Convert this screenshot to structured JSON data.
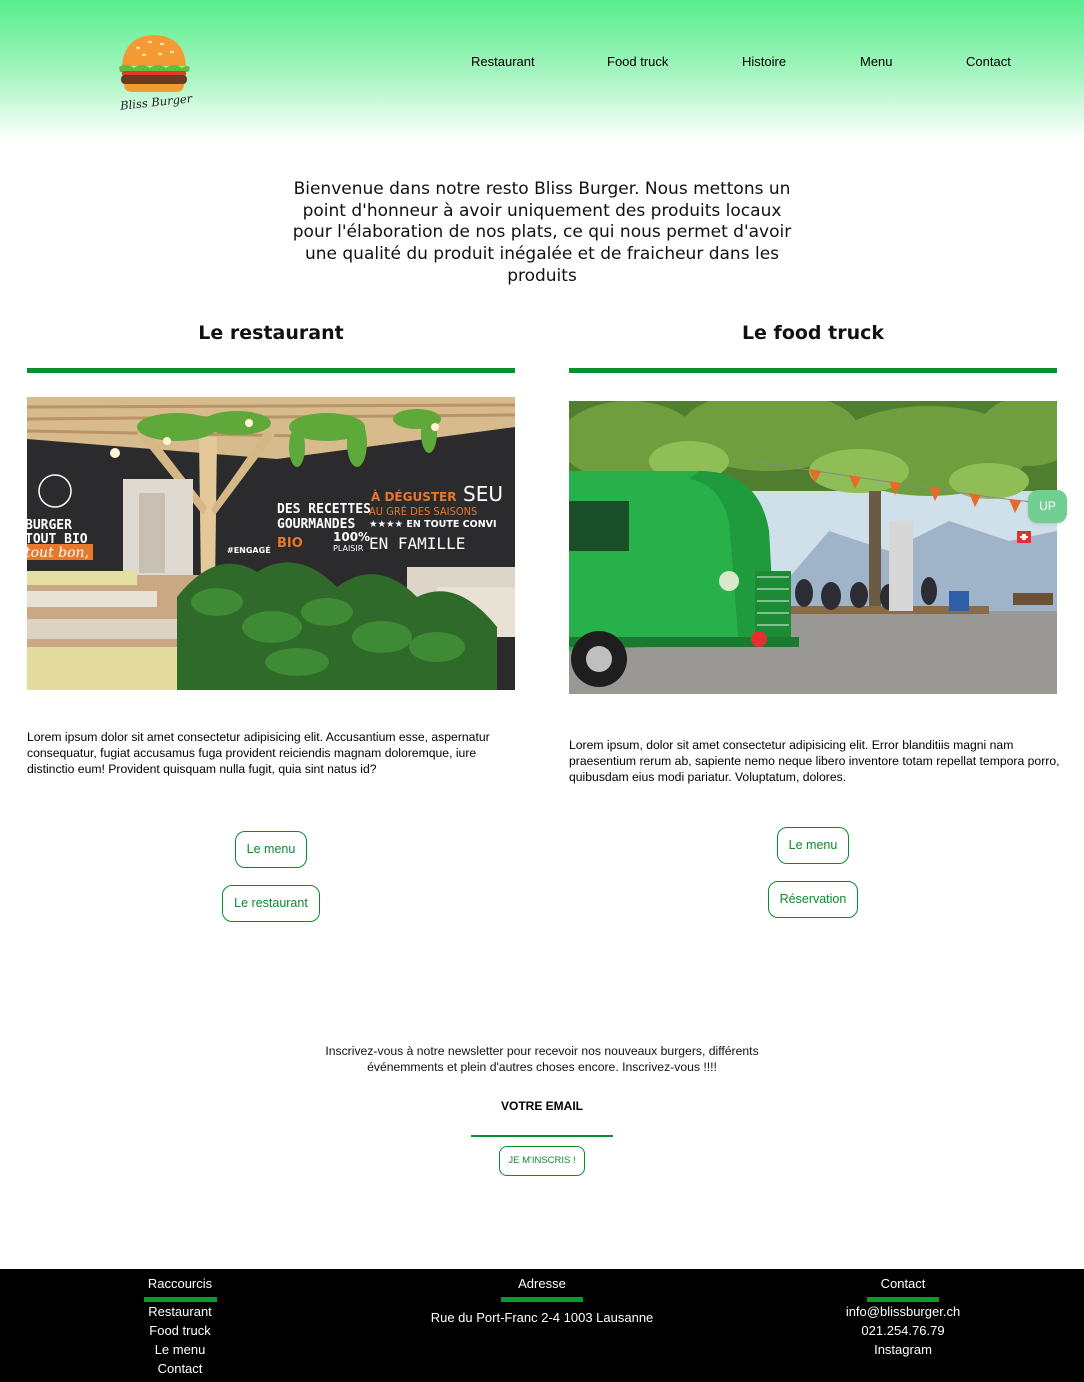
{
  "brand": {
    "logo_text": "Bliss Burger",
    "accent": "#07902d",
    "header_gradient_top": "#58ee8c"
  },
  "nav": {
    "items": [
      "Restaurant",
      "Food truck",
      "Histoire",
      "Menu",
      "Contact"
    ]
  },
  "intro": {
    "text": "Bienvenue dans notre resto Bliss Burger. Nous mettons un point d'honneur à avoir uniquement des produits locaux pour l'élaboration de nos plats, ce qui nous permet d'avoir une qualité du produit inégalée et de fraicheur dans les produits"
  },
  "restaurant": {
    "title": "Le restaurant",
    "text": "Lorem ipsum dolor sit amet consectetur adipisicing elit. Accusantium esse, aspernatur consequatur, fugiat accusamus fuga provident reiciendis magnam doloremque, iure distinctio eum! Provident quisquam nulla fugit, quia sint natus id?",
    "btn_menu": "Le menu",
    "btn_restaurant": "Le restaurant",
    "image": {
      "board_left_1": "BURGER",
      "board_left_2": "TOUT BIO",
      "board_left_3": "tout bon,",
      "board_title_1": "DES RECETTES",
      "board_title_2": "GOURMANDES",
      "board_bio": "BIO",
      "board_plaisir": "100%",
      "board_plaisir_2": "PLAISIR",
      "board_deguster": "À DÉGUSTER",
      "board_saisons": "AU GRÉ DES SAISONS",
      "board_conviv": "★★★★ EN TOUTE CONVI",
      "board_famille": "EN FAMILLE",
      "board_seu": "SEU",
      "board_engage": "#ENGAGÉ"
    }
  },
  "foodtruck": {
    "title": "Le food truck",
    "text": "Lorem ipsum, dolor sit amet consectetur adipisicing elit. Error blanditiis magni nam praesentium rerum ab, sapiente nemo neque libero inventore totam repellat tempora porro, quibusdam eius modi pariatur. Voluptatum, dolores.",
    "btn_menu": "Le menu",
    "btn_reservation": "Réservation"
  },
  "up_button": "UP",
  "newsletter": {
    "text": "Inscrivez-vous à notre newsletter pour recevoir nos nouveaux burgers, différents événemments et plein d'autres choses encore. Inscrivez-vous !!!!",
    "email_placeholder": "VOTRE EMAIL",
    "submit": "JE M'INSCRIS !"
  },
  "footer": {
    "shortcuts": {
      "title": "Raccourcis",
      "items": [
        "Restaurant",
        "Food truck",
        "Le menu",
        "Contact"
      ]
    },
    "address": {
      "title": "Adresse",
      "line": "Rue du Port-Franc 2-4 1003 Lausanne"
    },
    "contact": {
      "title": "Contact",
      "email": "info@blissburger.ch",
      "phone": "021.254.76.79",
      "social": "Instagram"
    }
  }
}
